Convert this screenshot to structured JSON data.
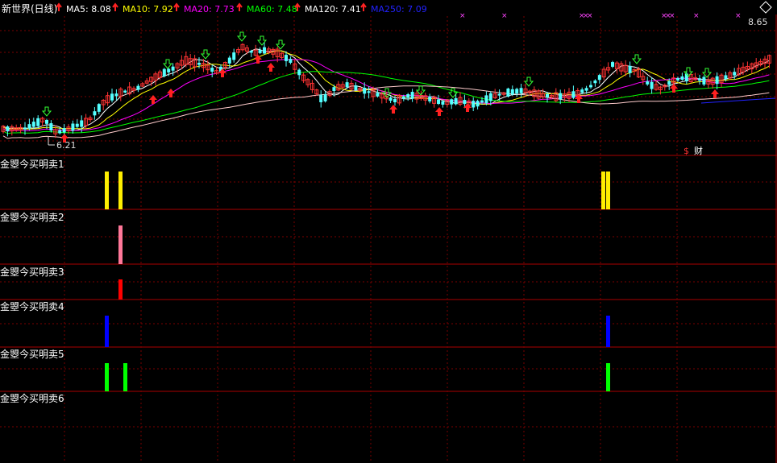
{
  "header": {
    "title": "新世界(日线)",
    "ma": [
      {
        "label": "MA5: 8.08",
        "color": "#ffffff"
      },
      {
        "label": "MA10: 7.92",
        "color": "#ffff00"
      },
      {
        "label": "MA20: 7.73",
        "color": "#ff00ff"
      },
      {
        "label": "MA60: 7.48",
        "color": "#00ff00"
      },
      {
        "label": "MA120: 7.41",
        "color": "#ffffff"
      },
      {
        "label": "MA250: 7.09",
        "color": "#2222ff"
      }
    ]
  },
  "price": {
    "high_label": "8.65",
    "low_label": "6.21",
    "finance_label": "财",
    "finance_symbol": "$"
  },
  "panels": [
    {
      "label": "金曌今买明卖1"
    },
    {
      "label": "金曌今买明卖2"
    },
    {
      "label": "金曌今买明卖3"
    },
    {
      "label": "金曌今买明卖4"
    },
    {
      "label": "金曌今买明卖5"
    },
    {
      "label": "金曌今买明卖6"
    }
  ],
  "colors": {
    "up": "#ff3333",
    "down": "#54ffff",
    "divider": "#aa0000",
    "grid": "#7a0000",
    "ma5": "#ffffff",
    "ma10": "#ffff00",
    "ma20": "#ff00ff",
    "ma60": "#00ff00",
    "ma120": "#ffffff",
    "ma250": "#2222ff"
  }
}
